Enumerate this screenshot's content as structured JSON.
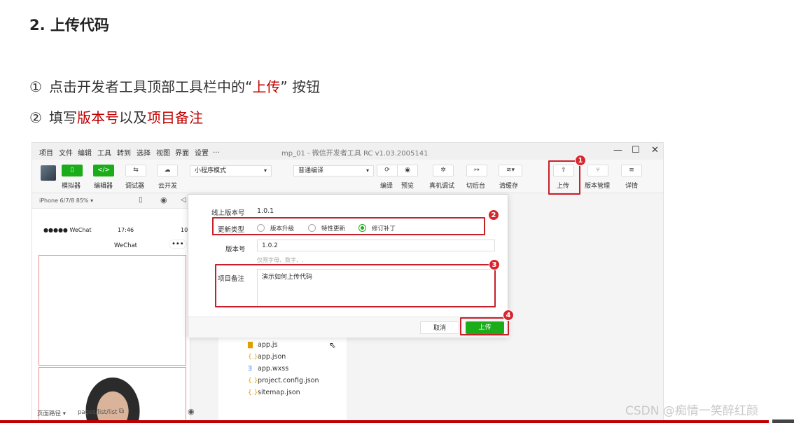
{
  "slide": {
    "heading": "2. 上传代码",
    "step1": {
      "num": "①",
      "pre": "点击开发者工具顶部工具栏中的“",
      "hl": "上传",
      "post": "” 按钮"
    },
    "step2": {
      "num": "②",
      "pre": "填写",
      "hl1": "版本号",
      "mid": "以及",
      "hl2": "项目备注"
    }
  },
  "window": {
    "menu": [
      "项目",
      "文件",
      "编辑",
      "工具",
      "转到",
      "选择",
      "视图",
      "界面",
      "设置",
      "..."
    ],
    "title": "mp_01 - 微信开发者工具 RC v1.03.2005141",
    "controls": {
      "min": "—",
      "max": "☐",
      "close": "✕"
    }
  },
  "toolbar": {
    "simulator": "模拟器",
    "editor": "编辑器",
    "debugger": "调试器",
    "cloud": "云开发",
    "mode_select": "小程序模式",
    "compile_select": "普通编译",
    "compile": "编译",
    "preview": "预览",
    "real_debug": "真机调试",
    "background": "切后台",
    "clear_cache": "清缓存",
    "upload": "上传",
    "version_mgmt": "版本管理",
    "details": "详情",
    "sim_icon": "phone-icon",
    "editor_icon": "</>"
  },
  "simulator": {
    "device": "iPhone 6/7/8 85% ▾",
    "signal": "●●●●● WeChat",
    "time": "17:46",
    "battery": "10",
    "nav_title": "WeChat",
    "menu_dots": "•••"
  },
  "files": [
    "app.js",
    "app.json",
    "app.wxss",
    "project.config.json",
    "sitemap.json"
  ],
  "statusbar": {
    "path_label": "页面路径 ▾",
    "path": "pages/list/list"
  },
  "dialog": {
    "online_version_label": "线上版本号",
    "online_version": "1.0.1",
    "update_type_label": "更新类型",
    "options": [
      {
        "label": "版本升级",
        "selected": false
      },
      {
        "label": "特性更新",
        "selected": false
      },
      {
        "label": "修订补丁",
        "selected": true
      }
    ],
    "version_label": "版本号",
    "version_value": "1.0.2",
    "version_hint": "仅限字母、数字、.",
    "note_label": "项目备注",
    "note_value": "演示如何上传代码",
    "cancel": "取消",
    "upload": "上传"
  },
  "badges": [
    "1",
    "2",
    "3",
    "4"
  ],
  "watermark": "CSDN @痴情一笑醉红颜",
  "colors": {
    "accent_red": "#c00000",
    "wechat_green": "#1aad19",
    "badge_red": "#d7262d"
  }
}
